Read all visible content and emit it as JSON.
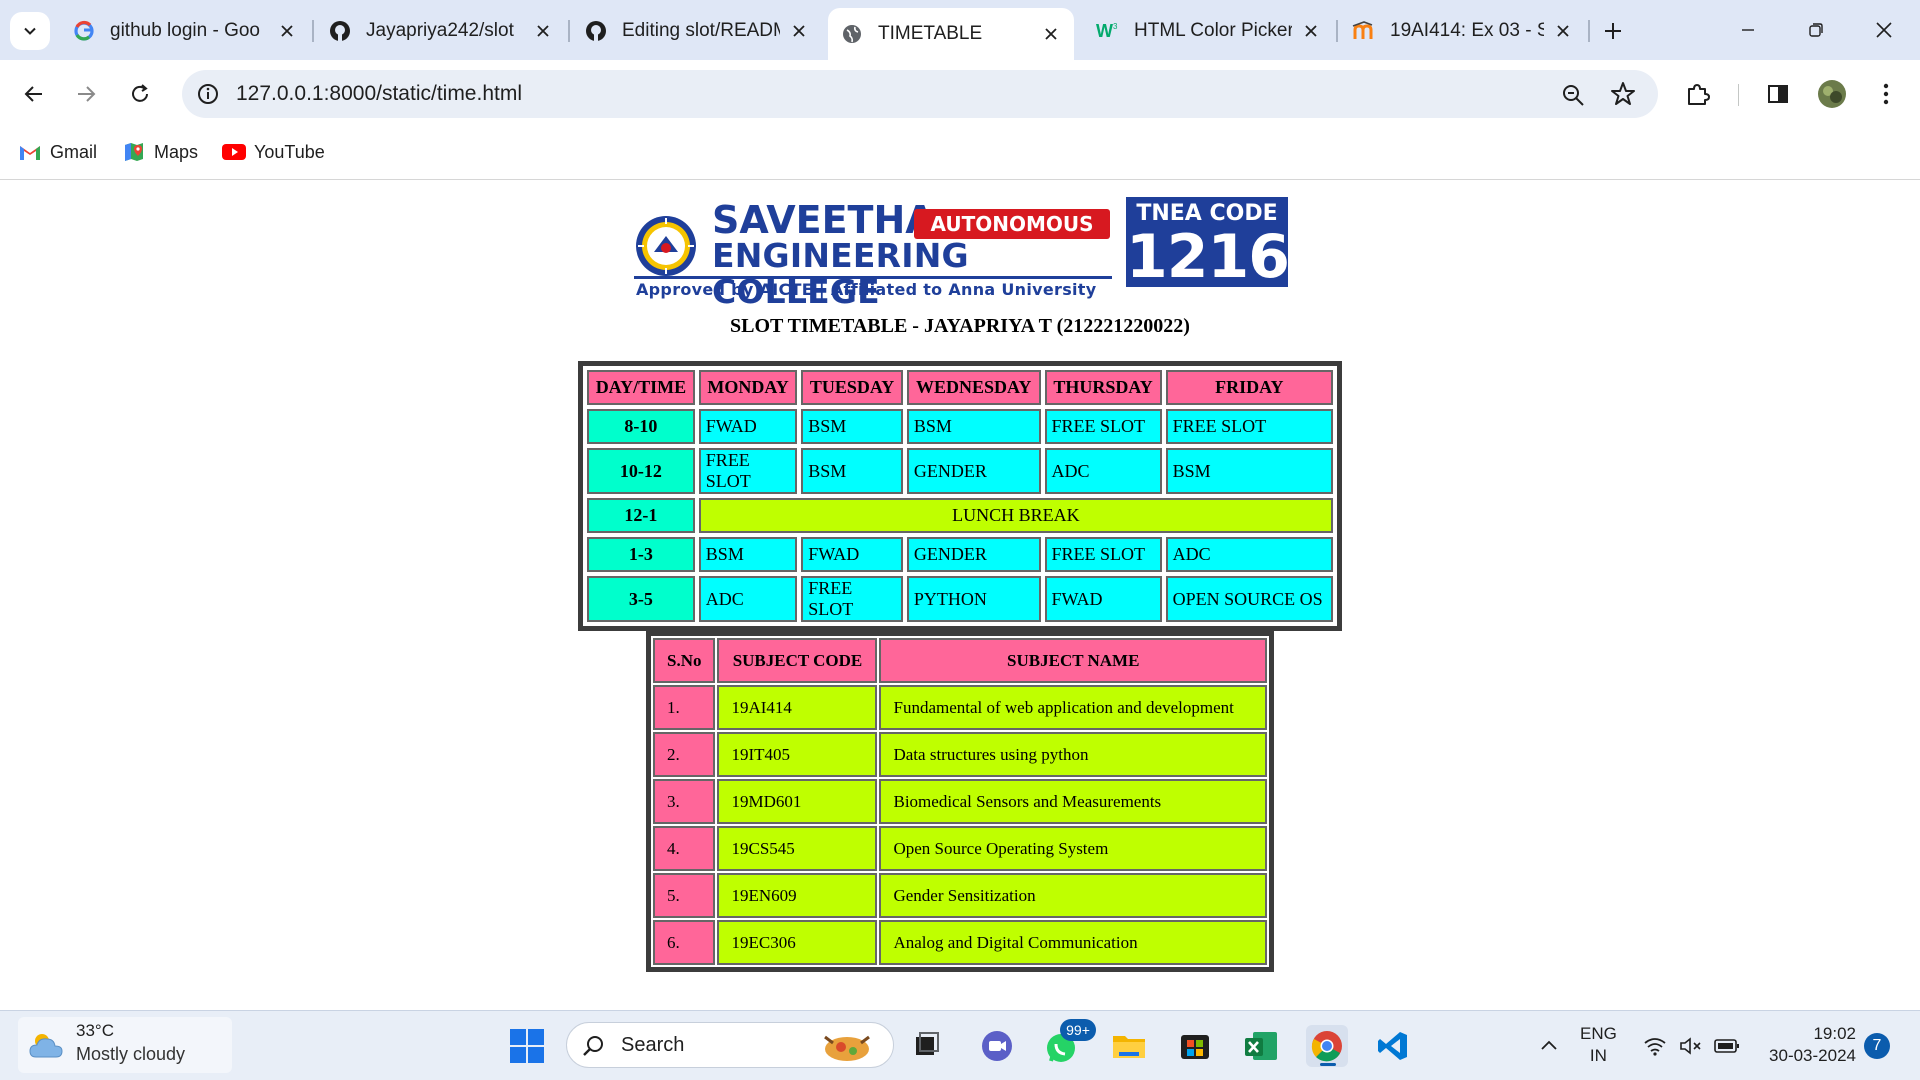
{
  "browser": {
    "tabs": [
      {
        "label": "github login - Goo",
        "icon": "google-icon",
        "active": false
      },
      {
        "label": "Jayapriya242/slot",
        "icon": "github-icon",
        "active": false
      },
      {
        "label": "Editing slot/READM",
        "icon": "github-icon",
        "active": false
      },
      {
        "label": "TIMETABLE",
        "icon": "globe-icon",
        "active": true
      },
      {
        "label": "HTML Color Picker",
        "icon": "w3schools-icon",
        "active": false
      },
      {
        "label": "19AI414: Ex 03 - Sl",
        "icon": "moodle-icon",
        "active": false
      }
    ],
    "url": "127.0.0.1:8000/static/time.html",
    "bookmarks": [
      {
        "label": "Gmail",
        "icon": "gmail-icon"
      },
      {
        "label": "Maps",
        "icon": "maps-icon"
      },
      {
        "label": "YouTube",
        "icon": "youtube-icon"
      }
    ]
  },
  "logo": {
    "name_line1": "SAVEETHA",
    "badge": "AUTONOMOUS",
    "name_line2": "ENGINEERING COLLEGE",
    "tagline": "Approved by AICTE  |  Affiliated to Anna University",
    "tnea_label": "TNEA CODE",
    "tnea_code": "1216"
  },
  "page_title": "SLOT TIMETABLE - JAYAPRIYA T (212221220022)",
  "timetable": {
    "headers": [
      "DAY/TIME",
      "MONDAY",
      "TUESDAY",
      "WEDNESDAY",
      "THURSDAY",
      "FRIDAY"
    ],
    "rows": [
      {
        "time": "8-10",
        "cells": [
          "FWAD",
          "BSM",
          "BSM",
          "FREE SLOT",
          "FREE SLOT"
        ]
      },
      {
        "time": "10-12",
        "cells": [
          "FREE SLOT",
          "BSM",
          "GENDER",
          "ADC",
          "BSM"
        ]
      },
      {
        "time": "12-1",
        "lunch": "LUNCH BREAK"
      },
      {
        "time": "1-3",
        "cells": [
          "BSM",
          "FWAD",
          "GENDER",
          "FREE SLOT",
          "ADC"
        ]
      },
      {
        "time": "3-5",
        "cells": [
          "ADC",
          "FREE SLOT",
          "PYTHON",
          "FWAD",
          "OPEN SOURCE OS"
        ]
      }
    ]
  },
  "subjects": {
    "headers": [
      "S.No",
      "SUBJECT CODE",
      "SUBJECT NAME"
    ],
    "rows": [
      {
        "sno": "1.",
        "code": "19AI414",
        "name": "Fundamental of web application and development"
      },
      {
        "sno": "2.",
        "code": "19IT405",
        "name": "Data structures using python"
      },
      {
        "sno": "3.",
        "code": "19MD601",
        "name": "Biomedical Sensors and Measurements"
      },
      {
        "sno": "4.",
        "code": "19CS545",
        "name": "Open Source Operating System"
      },
      {
        "sno": "5.",
        "code": "19EN609",
        "name": "Gender Sensitization"
      },
      {
        "sno": "6.",
        "code": "19EC306",
        "name": "Analog and Digital Communication"
      }
    ]
  },
  "taskbar": {
    "weather_temp": "33°C",
    "weather_cond": "Mostly cloudy",
    "search_label": "Search",
    "whatsapp_badge": "99+",
    "lang_line1": "ENG",
    "lang_line2": "IN",
    "time": "19:02",
    "date": "30-03-2024",
    "notifications": "7"
  },
  "colors": {
    "header_pink": "#ff6699",
    "time_cyan": "#00ffcc",
    "cell_cyan": "#00ffff",
    "lunch_lime": "#bfff00",
    "brand_blue": "#1f3f9a",
    "brand_red": "#d71920"
  }
}
